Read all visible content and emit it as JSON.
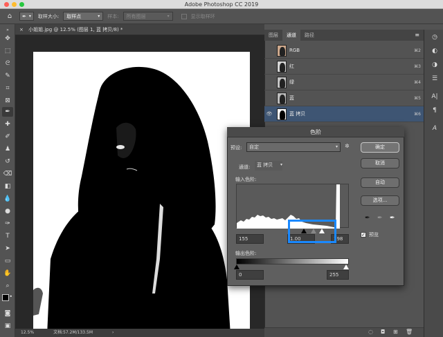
{
  "app": {
    "title": "Adobe Photoshop CC 2019"
  },
  "colors": {
    "accent_blue": "#1a89ff",
    "selected_row": "#3e5573",
    "traffic_red": "#fe5f57",
    "traffic_yellow": "#febc2e",
    "traffic_green": "#28c840"
  },
  "options": {
    "sample_size_label": "取样大小:",
    "sample_size_value": "取样点",
    "sample_label": "样本:",
    "sample_value": "所有图层",
    "show_ring_label": "显示取样环"
  },
  "document": {
    "tab_title": "小姐姐.jpg @ 12.5% (图层 1, 蓝 拷贝/8) *",
    "zoom": "12.5%",
    "doc_size": "文档:57.2M/133.5M"
  },
  "panel": {
    "tabs": [
      "图层",
      "通道",
      "路径"
    ],
    "active_tab": 1,
    "channels": [
      {
        "name": "RGB",
        "shortcut": "⌘2",
        "selected": false
      },
      {
        "name": "红",
        "shortcut": "⌘3",
        "selected": false
      },
      {
        "name": "绿",
        "shortcut": "⌘4",
        "selected": false
      },
      {
        "name": "蓝",
        "shortcut": "⌘5",
        "selected": false
      },
      {
        "name": "蓝 拷贝",
        "shortcut": "⌘6",
        "selected": true
      }
    ]
  },
  "levels": {
    "title": "色阶",
    "preset_label": "预设:",
    "preset_value": "自定",
    "channel_label": "通道:",
    "channel_value": "蓝 拷贝",
    "input_label": "输入色阶:",
    "input_black": "155",
    "input_mid": "1.00",
    "input_white": "198",
    "output_label": "输出色阶:",
    "output_black": "0",
    "output_white": "255",
    "ok": "确定",
    "cancel": "取消",
    "auto": "自动",
    "options": "选项...",
    "preview_label": "预览",
    "preview_checked": true
  }
}
